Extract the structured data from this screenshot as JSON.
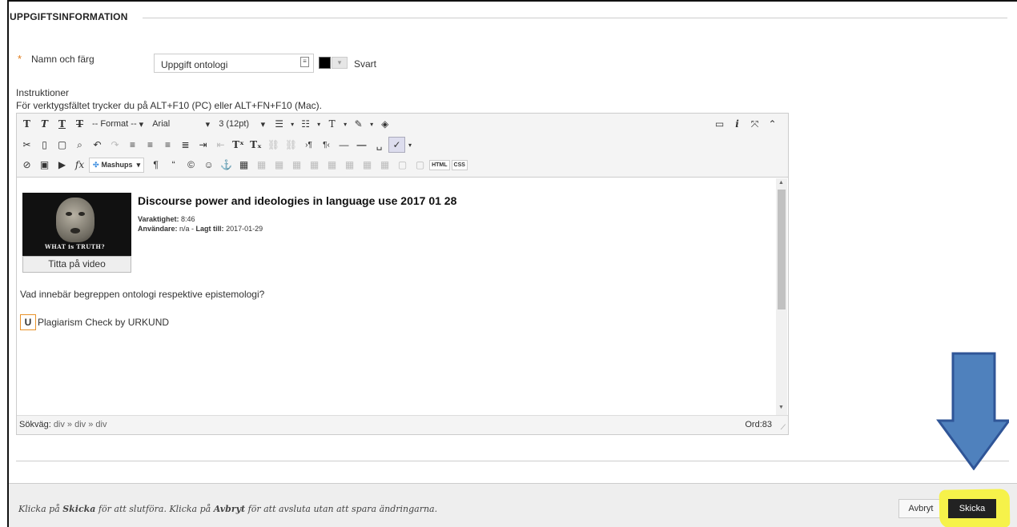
{
  "section": {
    "title": "UPPGIFTSINFORMATION"
  },
  "name_field": {
    "required_mark": "*",
    "label": "Namn och färg",
    "value": "Uppgift ontologi",
    "color_name": "Svart",
    "color_hex": "#000000"
  },
  "instructions": {
    "label": "Instruktioner",
    "hint": "För verktygsfältet trycker du på ALT+F10 (PC) eller ALT+FN+F10 (Mac)."
  },
  "toolbar": {
    "format_select": "-- Format --",
    "font_select": "Arial",
    "size_select": "3 (12pt)",
    "mashups_label": "Mashups",
    "html_label": "HTML",
    "css_label": "CSS"
  },
  "content": {
    "video": {
      "title": "Discourse power and ideologies in language use 2017 01 28",
      "duration_label": "Varaktighet:",
      "duration_value": "8:46",
      "user_label": "Användare:",
      "user_value": "n/a",
      "added_label": "Lagt till:",
      "added_value": "2017-01-29",
      "thumb_caption": "WHAT is TRUTH?",
      "watch_button": "Titta på video"
    },
    "question": "Vad innebär begreppen ontologi respektive epistemologi?",
    "plagiarism_icon_letter": "U",
    "plagiarism_text": "Plagiarism Check by URKUND"
  },
  "statusbar": {
    "path_label": "Sökväg:",
    "path_value": "div » div » div",
    "word_count": "Ord:83"
  },
  "footer": {
    "text_1": "Klicka på ",
    "text_submit": "Skicka",
    "text_2": " för att slutföra. Klicka på ",
    "text_cancel": "Avbryt",
    "text_3": " för att avsluta utan att spara ändringarna.",
    "cancel_button": "Avbryt",
    "submit_button": "Skicka"
  },
  "colors": {
    "highlight": "#f6f24a",
    "arrow": "#4f81bd",
    "required": "#e07b1a"
  }
}
